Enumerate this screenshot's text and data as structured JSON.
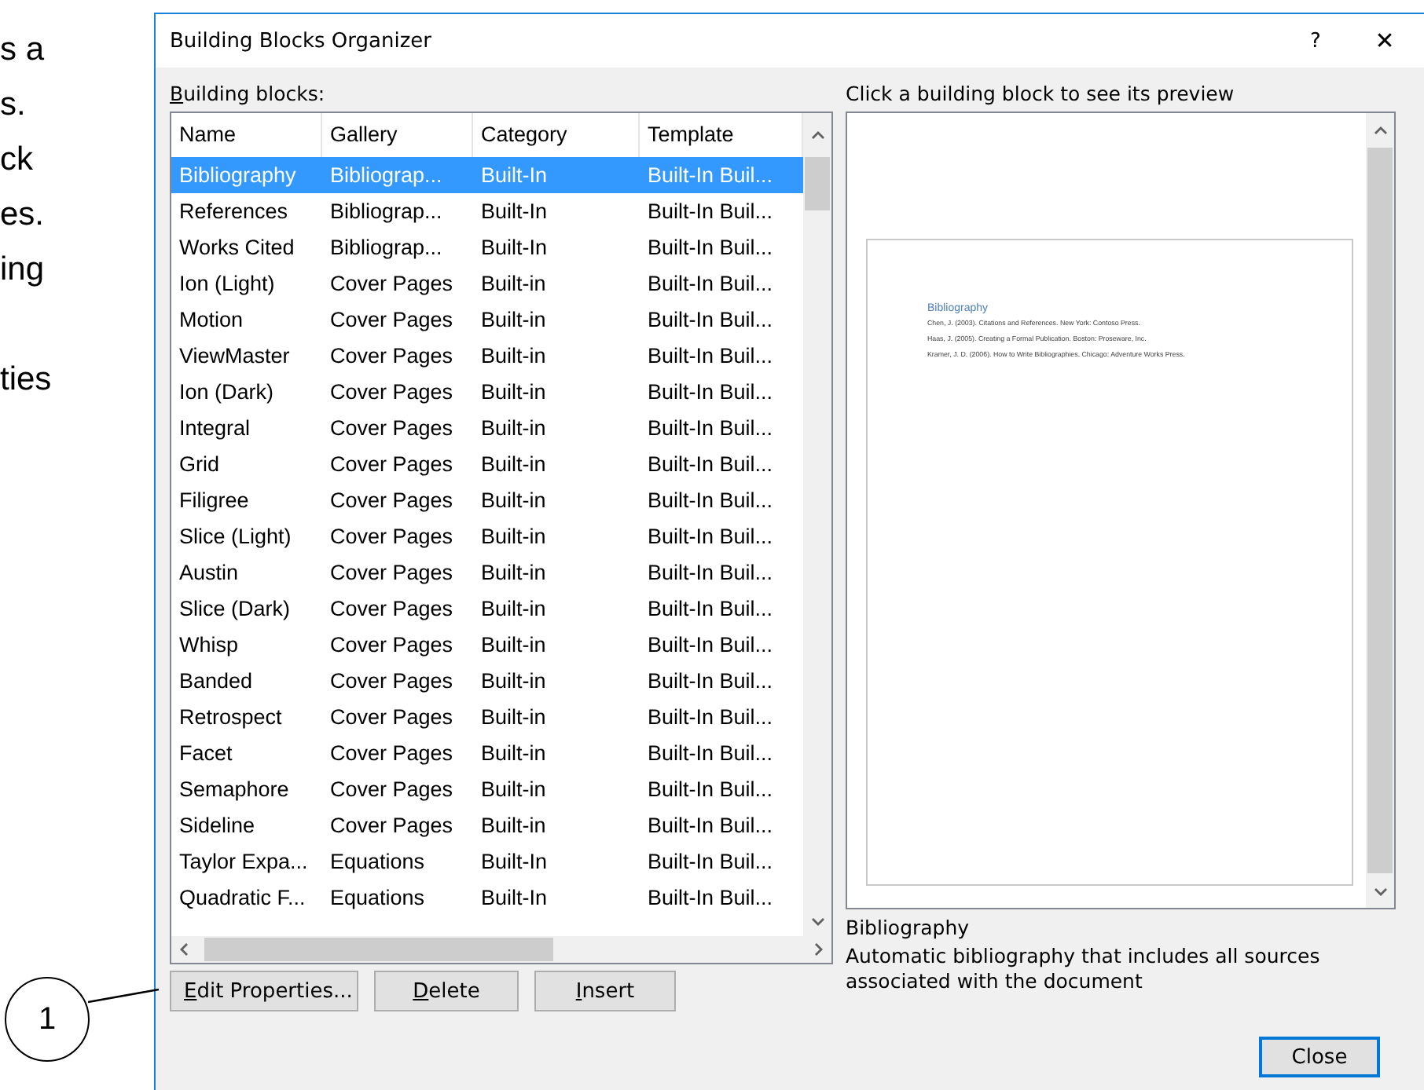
{
  "side_text": [
    "s a",
    "s.",
    "ck",
    "es.",
    "ing",
    "ties"
  ],
  "callout": {
    "label": "1"
  },
  "window": {
    "title": "Building Blocks Organizer",
    "help": "?",
    "close": "✕"
  },
  "list_label": {
    "text": "Building blocks:",
    "mnemonic_first": true
  },
  "table": {
    "columns": [
      "Name",
      "Gallery",
      "Category",
      "Template"
    ],
    "rows": [
      {
        "cells": [
          "Bibliography",
          "Bibliograp...",
          "Built-In",
          "Built-In Buil..."
        ],
        "selected": true
      },
      {
        "cells": [
          "References",
          "Bibliograp...",
          "Built-In",
          "Built-In Buil..."
        ],
        "selected": false
      },
      {
        "cells": [
          "Works Cited",
          "Bibliograp...",
          "Built-In",
          "Built-In Buil..."
        ],
        "selected": false
      },
      {
        "cells": [
          "Ion (Light)",
          "Cover Pages",
          "Built-in",
          "Built-In Buil..."
        ],
        "selected": false
      },
      {
        "cells": [
          "Motion",
          "Cover Pages",
          "Built-in",
          "Built-In Buil..."
        ],
        "selected": false
      },
      {
        "cells": [
          "ViewMaster",
          "Cover Pages",
          "Built-in",
          "Built-In Buil..."
        ],
        "selected": false
      },
      {
        "cells": [
          "Ion (Dark)",
          "Cover Pages",
          "Built-in",
          "Built-In Buil..."
        ],
        "selected": false
      },
      {
        "cells": [
          "Integral",
          "Cover Pages",
          "Built-in",
          "Built-In Buil..."
        ],
        "selected": false
      },
      {
        "cells": [
          "Grid",
          "Cover Pages",
          "Built-in",
          "Built-In Buil..."
        ],
        "selected": false
      },
      {
        "cells": [
          "Filigree",
          "Cover Pages",
          "Built-in",
          "Built-In Buil..."
        ],
        "selected": false
      },
      {
        "cells": [
          "Slice (Light)",
          "Cover Pages",
          "Built-in",
          "Built-In Buil..."
        ],
        "selected": false
      },
      {
        "cells": [
          "Austin",
          "Cover Pages",
          "Built-in",
          "Built-In Buil..."
        ],
        "selected": false
      },
      {
        "cells": [
          "Slice (Dark)",
          "Cover Pages",
          "Built-in",
          "Built-In Buil..."
        ],
        "selected": false
      },
      {
        "cells": [
          "Whisp",
          "Cover Pages",
          "Built-in",
          "Built-In Buil..."
        ],
        "selected": false
      },
      {
        "cells": [
          "Banded",
          "Cover Pages",
          "Built-in",
          "Built-In Buil..."
        ],
        "selected": false
      },
      {
        "cells": [
          "Retrospect",
          "Cover Pages",
          "Built-in",
          "Built-In Buil..."
        ],
        "selected": false
      },
      {
        "cells": [
          "Facet",
          "Cover Pages",
          "Built-in",
          "Built-In Buil..."
        ],
        "selected": false
      },
      {
        "cells": [
          "Semaphore",
          "Cover Pages",
          "Built-in",
          "Built-In Buil..."
        ],
        "selected": false
      },
      {
        "cells": [
          "Sideline",
          "Cover Pages",
          "Built-in",
          "Built-In Buil..."
        ],
        "selected": false
      },
      {
        "cells": [
          "Taylor Expa...",
          "Equations",
          "Built-In",
          "Built-In Buil..."
        ],
        "selected": false
      },
      {
        "cells": [
          "Quadratic F...",
          "Equations",
          "Built-In",
          "Built-In Buil..."
        ],
        "selected": false
      }
    ]
  },
  "buttons": [
    {
      "label": "Edit Properties...",
      "mnemonic_first": true
    },
    {
      "label": "Delete",
      "mnemonic_first": true
    },
    {
      "label": "Insert",
      "mnemonic_first": true
    }
  ],
  "preview": {
    "label": "Click a building block to see its preview",
    "heading": "Bibliography",
    "entries": [
      "Chen, J. (2003). Citations and References. New York: Contoso Press.",
      "Haas, J. (2005). Creating a Formal Publication. Boston: Proseware, Inc.",
      "Kramer, J. D. (2006). How to Write Bibliographies. Chicago: Adventure Works Press."
    ],
    "name": "Bibliography",
    "description": "Automatic bibliography that includes all sources associated with the document"
  },
  "close_button": {
    "label": "Close",
    "default": true
  }
}
